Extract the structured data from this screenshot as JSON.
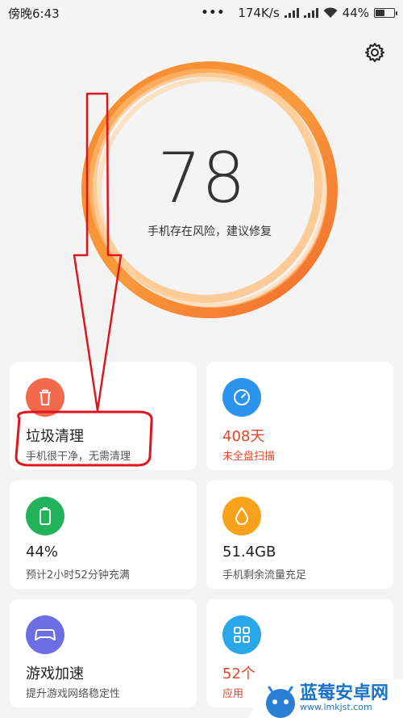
{
  "status_bar": {
    "time": "傍晚6:43",
    "dots": "•••",
    "network_speed": "174K/s",
    "battery_text": "44%",
    "battery_level": 0.44
  },
  "score": {
    "value": "78",
    "caption": "手机存在风险，建议修复"
  },
  "cards": {
    "cleanup": {
      "title": "垃圾清理",
      "subtitle": "手机很干净，无需清理",
      "icon": "trash-icon",
      "color": "#f26a4b"
    },
    "virus": {
      "title": "408天",
      "subtitle": "未全盘扫描",
      "icon": "speedometer-icon",
      "color": "#2a93ec"
    },
    "battery": {
      "title": "44%",
      "subtitle": "预计2小时52分钟充满",
      "icon": "battery-icon",
      "color": "#22b35a"
    },
    "traffic": {
      "title": "51.4GB",
      "subtitle": "手机剩余流量充足",
      "icon": "drop-icon",
      "color": "#f7a21a"
    },
    "game": {
      "title": "游戏加速",
      "subtitle": "提升游戏网络稳定性",
      "icon": "gamepad-icon",
      "color": "#6e6ee4"
    },
    "apps": {
      "title": "52个",
      "subtitle": "应用",
      "icon": "grid-icon",
      "color": "#2aa7e8"
    }
  },
  "watermark": {
    "brand": "蓝莓安卓网",
    "url": "www.lmkjst.com"
  },
  "colors": {
    "ring_outer": "#f5762e",
    "ring_inner": "#ffc98a",
    "annotation": "#e0141e",
    "warn": "#e4442a"
  }
}
